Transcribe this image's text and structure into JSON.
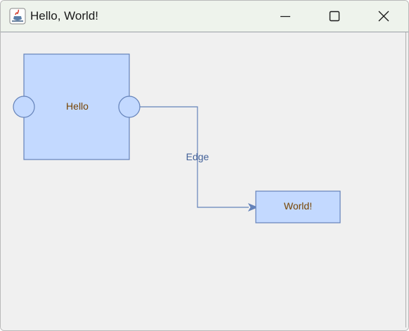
{
  "window": {
    "title": "Hello, World!",
    "app_icon": "java-coffee-cup-icon",
    "controls": {
      "minimize_icon": "minimize-icon",
      "maximize_icon": "maximize-icon",
      "close_icon": "close-icon"
    }
  },
  "graph": {
    "colors": {
      "node_fill": "#c3d9ff",
      "node_stroke": "#6482b9",
      "edge_stroke": "#6482b9",
      "node_text": "#774400",
      "edge_text": "#446299"
    },
    "nodes": {
      "hello": {
        "label": "Hello"
      },
      "world": {
        "label": "World!"
      }
    },
    "edge": {
      "label": "Edge"
    }
  }
}
